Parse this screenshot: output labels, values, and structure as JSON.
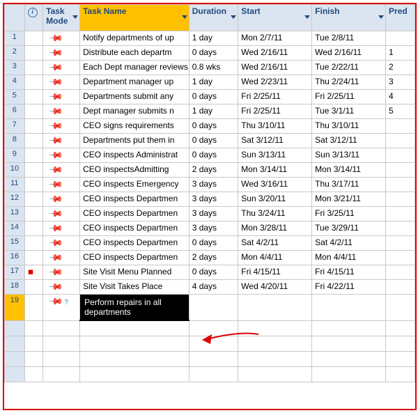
{
  "headers": {
    "info": "",
    "mode": "Task Mode",
    "name": "Task Name",
    "duration": "Duration",
    "start": "Start",
    "finish": "Finish",
    "pred": "Pred"
  },
  "info_tooltip": "i",
  "rows": [
    {
      "n": "1",
      "info": "",
      "mode": "pin",
      "name": "Notify departments of up",
      "dur": "1 day",
      "start": "Mon 2/7/11",
      "fin": "Tue 2/8/11",
      "pred": ""
    },
    {
      "n": "2",
      "info": "",
      "mode": "pin",
      "name": "Distribute each departm",
      "dur": "0 days",
      "start": "Wed 2/16/11",
      "fin": "Wed 2/16/11",
      "pred": "1"
    },
    {
      "n": "3",
      "info": "",
      "mode": "pin",
      "name": "Each Dept manager reviews curent policy manual",
      "dur": "0.8 wks",
      "start": "Wed 2/16/11",
      "fin": "Tue 2/22/11",
      "pred": "2"
    },
    {
      "n": "4",
      "info": "",
      "mode": "pin",
      "name": "Department manager up",
      "dur": "1 day",
      "start": "Wed 2/23/11",
      "fin": "Thu 2/24/11",
      "pred": "3"
    },
    {
      "n": "5",
      "info": "",
      "mode": "pin",
      "name": "Departments submit any",
      "dur": "0 days",
      "start": "Fri 2/25/11",
      "fin": "Fri 2/25/11",
      "pred": "4"
    },
    {
      "n": "6",
      "info": "",
      "mode": "pin",
      "name": "Dept manager submits n",
      "dur": "1 day",
      "start": "Fri 2/25/11",
      "fin": "Tue 3/1/11",
      "pred": "5"
    },
    {
      "n": "7",
      "info": "",
      "mode": "pin",
      "name": "CEO signs requirements",
      "dur": "0 days",
      "start": "Thu 3/10/11",
      "fin": "Thu 3/10/11",
      "pred": ""
    },
    {
      "n": "8",
      "info": "",
      "mode": "pin",
      "name": "Departments put them in",
      "dur": "0 days",
      "start": "Sat 3/12/11",
      "fin": "Sat 3/12/11",
      "pred": ""
    },
    {
      "n": "9",
      "info": "",
      "mode": "pin",
      "name": "CEO inspects Administrat",
      "dur": "0 days",
      "start": "Sun 3/13/11",
      "fin": "Sun 3/13/11",
      "pred": ""
    },
    {
      "n": "10",
      "info": "",
      "mode": "pin",
      "name": "CEO inspectsAdmitting",
      "dur": "2 days",
      "start": "Mon 3/14/11",
      "fin": "Mon 3/14/11",
      "pred": ""
    },
    {
      "n": "11",
      "info": "",
      "mode": "pin",
      "name": "CEO inspects Emergency",
      "dur": "3 days",
      "start": "Wed 3/16/11",
      "fin": "Thu 3/17/11",
      "pred": ""
    },
    {
      "n": "12",
      "info": "",
      "mode": "pin",
      "name": "CEO inspects Departmen",
      "dur": "3 days",
      "start": "Sun 3/20/11",
      "fin": "Mon 3/21/11",
      "pred": ""
    },
    {
      "n": "13",
      "info": "",
      "mode": "pin",
      "name": "CEO inspects Departmen",
      "dur": "3 days",
      "start": "Thu 3/24/11",
      "fin": "Fri 3/25/11",
      "pred": ""
    },
    {
      "n": "14",
      "info": "",
      "mode": "pin",
      "name": "CEO inspects Departmen",
      "dur": "3 days",
      "start": "Mon 3/28/11",
      "fin": "Tue 3/29/11",
      "pred": ""
    },
    {
      "n": "15",
      "info": "",
      "mode": "pin",
      "name": "CEO inspects Departmen",
      "dur": "0 days",
      "start": "Sat 4/2/11",
      "fin": "Sat 4/2/11",
      "pred": ""
    },
    {
      "n": "16",
      "info": "",
      "mode": "pin",
      "name": "CEO inspects Departmen",
      "dur": "2 days",
      "start": "Mon 4/4/11",
      "fin": "Mon 4/4/11",
      "pred": ""
    },
    {
      "n": "17",
      "info": "warn",
      "mode": "pin",
      "name": "Site Visit Menu Planned",
      "dur": "0 days",
      "start": "Fri 4/15/11",
      "fin": "Fri 4/15/11",
      "pred": ""
    },
    {
      "n": "18",
      "info": "",
      "mode": "pin",
      "name": "Site Visit Takes Place",
      "dur": "4 days",
      "start": "Wed 4/20/11",
      "fin": "Fri 4/22/11",
      "pred": ""
    }
  ],
  "edit_row": {
    "n": "19",
    "mode": "pinq",
    "text": "Perform repairs in all departments"
  },
  "empty_rows": 4
}
